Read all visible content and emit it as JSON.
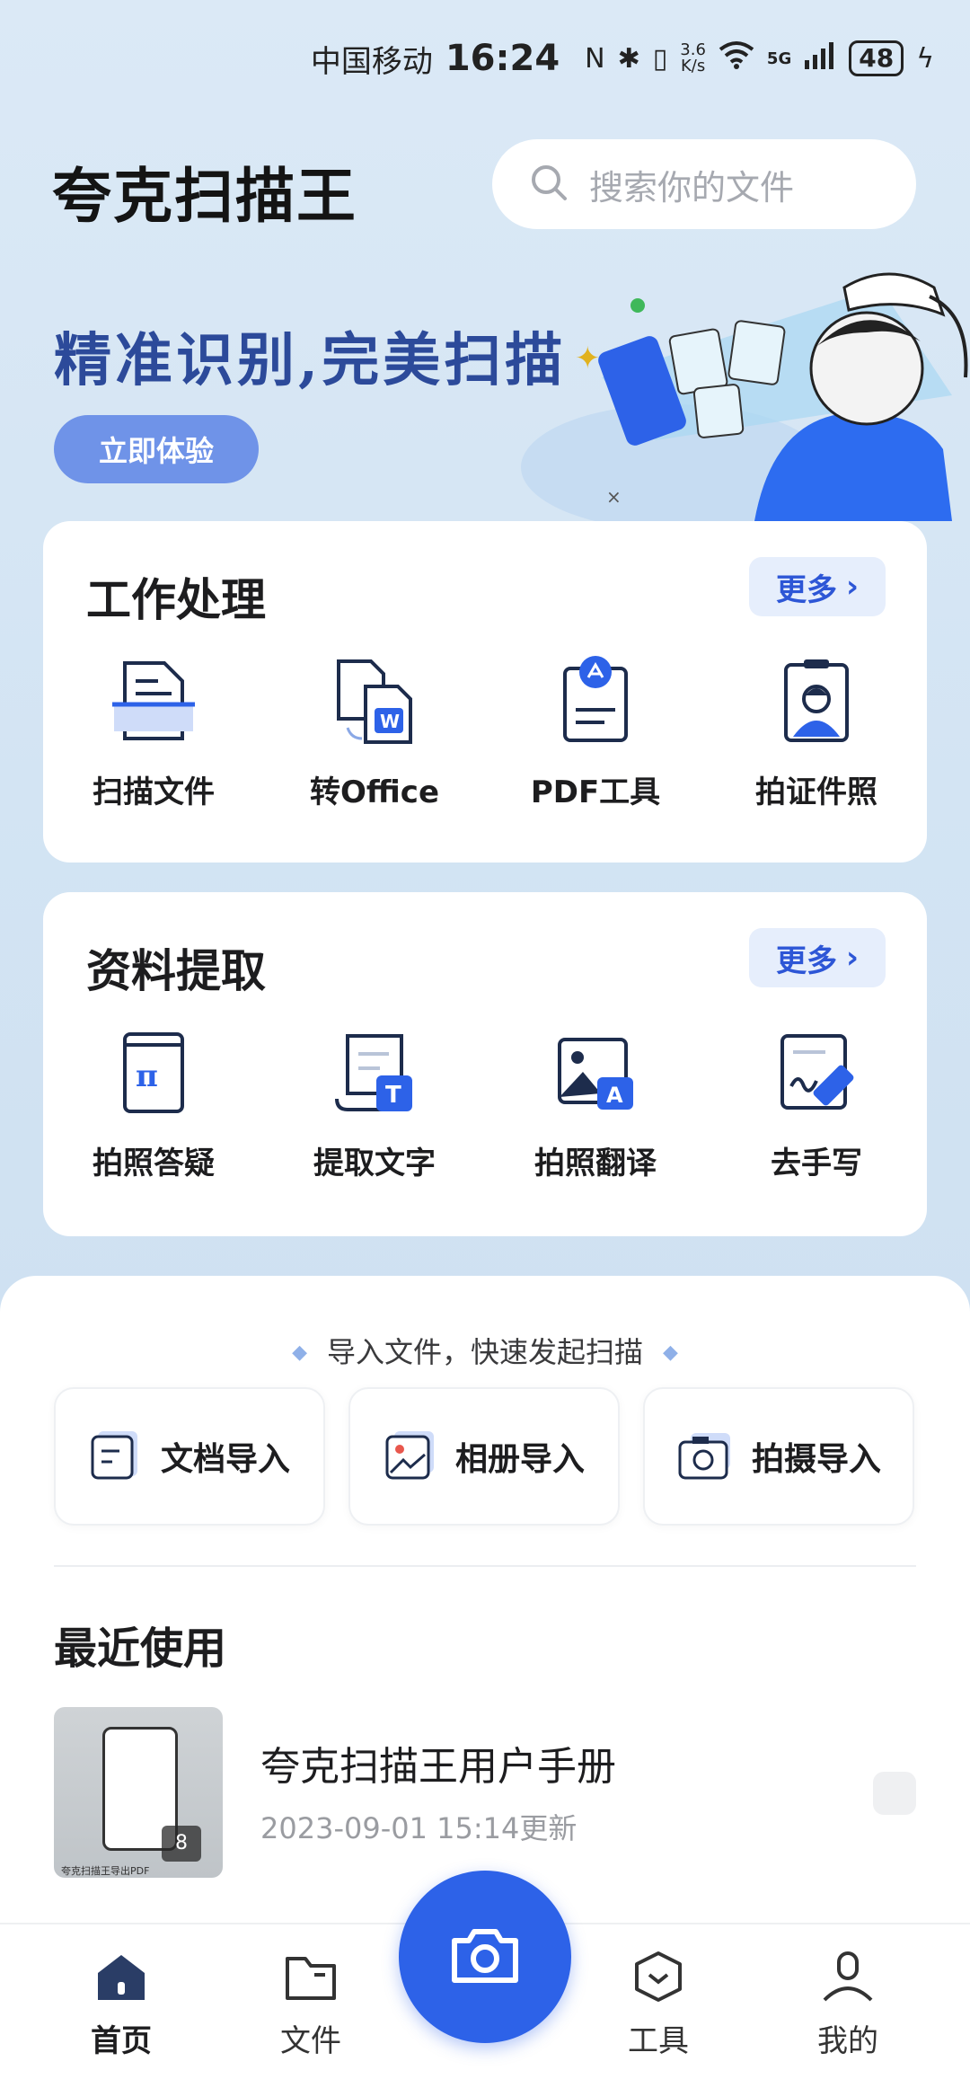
{
  "status_bar": {
    "carrier": "中国移动",
    "time": "16:24",
    "net_speed_value": "3.6",
    "net_speed_unit": "K/s",
    "network": "5G",
    "battery": "48"
  },
  "header": {
    "app_title": "夸克扫描王",
    "search_placeholder": "搜索你的文件"
  },
  "banner": {
    "title": "精准识别,完美扫描",
    "cta_label": "立即体验"
  },
  "work_section": {
    "title": "工作处理",
    "more_label": "更多",
    "tools": [
      {
        "label": "扫描文件",
        "icon": "scan-document-icon"
      },
      {
        "label": "转Office",
        "icon": "convert-office-icon"
      },
      {
        "label": "PDF工具",
        "icon": "pdf-tool-icon"
      },
      {
        "label": "拍证件照",
        "icon": "id-photo-icon"
      }
    ]
  },
  "extract_section": {
    "title": "资料提取",
    "more_label": "更多",
    "tools": [
      {
        "label": "拍照答疑",
        "icon": "question-answer-icon"
      },
      {
        "label": "提取文字",
        "icon": "extract-text-icon"
      },
      {
        "label": "拍照翻译",
        "icon": "photo-translate-icon"
      },
      {
        "label": "去手写",
        "icon": "remove-handwriting-icon"
      }
    ]
  },
  "import": {
    "hint": "导入文件，快速发起扫描",
    "buttons": [
      {
        "label": "文档导入",
        "icon": "document-import-icon"
      },
      {
        "label": "相册导入",
        "icon": "album-import-icon"
      },
      {
        "label": "拍摄导入",
        "icon": "camera-import-icon"
      }
    ]
  },
  "recent": {
    "title": "最近使用",
    "items": [
      {
        "name": "夸克扫描王用户手册",
        "meta": "2023-09-01 15:14更新",
        "page_count": "8",
        "thumb_caption": "夸克扫描王导出PDF"
      }
    ]
  },
  "bottom_nav": {
    "items": [
      {
        "label": "首页",
        "icon": "home-icon",
        "active": true
      },
      {
        "label": "文件",
        "icon": "folder-icon",
        "active": false
      },
      {
        "label": "工具",
        "icon": "tools-icon",
        "active": false
      },
      {
        "label": "我的",
        "icon": "profile-icon",
        "active": false
      }
    ],
    "camera_icon": "camera-icon"
  },
  "colors": {
    "accent": "#2d62e8",
    "banner_title": "#2c4a9a",
    "cta_bg": "#6f93e8",
    "background": "#d6e6f4"
  }
}
